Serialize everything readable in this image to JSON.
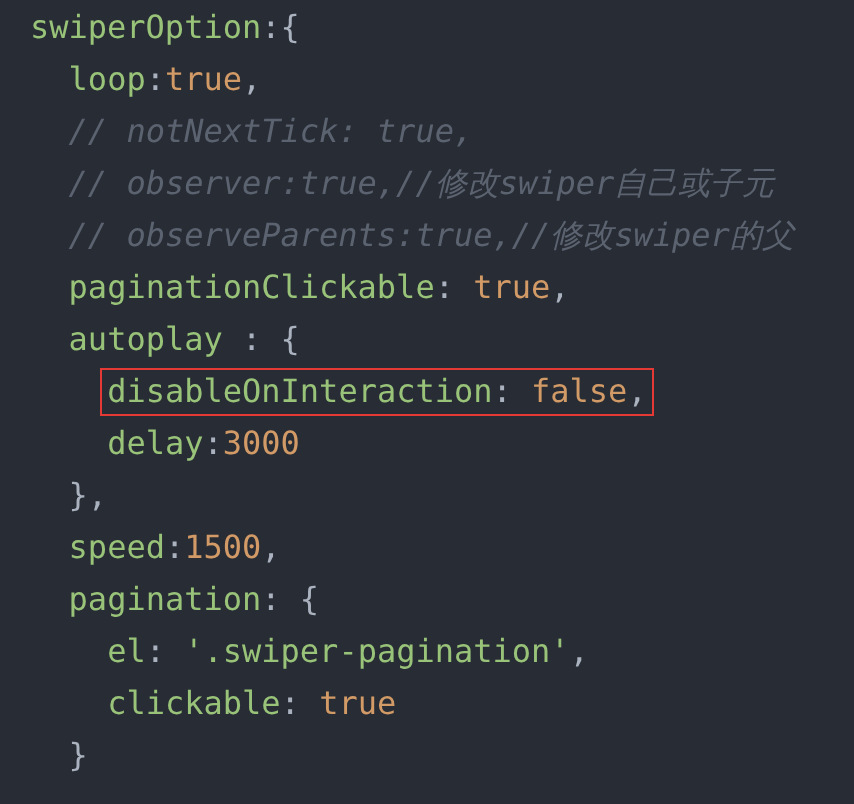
{
  "code_lines": [
    {
      "highlighted": false,
      "tokens": [
        {
          "kind": "key",
          "text": "swiperOption"
        },
        {
          "kind": "punct",
          "text": ":{"
        }
      ],
      "children": [
        {
          "highlighted": false,
          "tokens": [
            {
              "kind": "key",
              "text": "loop"
            },
            {
              "kind": "punct",
              "text": ":"
            },
            {
              "kind": "literal",
              "text": "true"
            },
            {
              "kind": "punct",
              "text": ","
            }
          ]
        },
        {
          "highlighted": false,
          "tokens": [
            {
              "kind": "comment",
              "text": "// notNextTick: true,"
            }
          ]
        },
        {
          "highlighted": false,
          "tokens": [
            {
              "kind": "comment",
              "text": "// observer:true,//修改swiper自己或子元"
            }
          ]
        },
        {
          "highlighted": false,
          "tokens": [
            {
              "kind": "comment",
              "text": "// observeParents:true,//修改swiper的父"
            }
          ]
        },
        {
          "highlighted": false,
          "tokens": [
            {
              "kind": "key",
              "text": "paginationClickable"
            },
            {
              "kind": "punct",
              "text": ": "
            },
            {
              "kind": "literal",
              "text": "true"
            },
            {
              "kind": "punct",
              "text": ","
            }
          ]
        },
        {
          "highlighted": false,
          "tokens": [
            {
              "kind": "key",
              "text": "autoplay"
            },
            {
              "kind": "punct",
              "text": " : {"
            }
          ],
          "children": [
            {
              "highlighted": true,
              "tokens": [
                {
                  "kind": "key",
                  "text": "disableOnInteraction"
                },
                {
                  "kind": "punct",
                  "text": ": "
                },
                {
                  "kind": "literal",
                  "text": "false"
                },
                {
                  "kind": "punct",
                  "text": ","
                }
              ]
            },
            {
              "highlighted": false,
              "tokens": [
                {
                  "kind": "key",
                  "text": "delay"
                },
                {
                  "kind": "punct",
                  "text": ":"
                },
                {
                  "kind": "literal",
                  "text": "3000"
                }
              ]
            }
          ]
        },
        {
          "highlighted": false,
          "tokens": [
            {
              "kind": "punct",
              "text": "},"
            }
          ]
        },
        {
          "highlighted": false,
          "tokens": [
            {
              "kind": "key",
              "text": "speed"
            },
            {
              "kind": "punct",
              "text": ":"
            },
            {
              "kind": "literal",
              "text": "1500"
            },
            {
              "kind": "punct",
              "text": ","
            }
          ]
        },
        {
          "highlighted": false,
          "tokens": [
            {
              "kind": "key",
              "text": "pagination"
            },
            {
              "kind": "punct",
              "text": ": {"
            }
          ],
          "children": [
            {
              "highlighted": false,
              "tokens": [
                {
                  "kind": "key",
                  "text": "el"
                },
                {
                  "kind": "punct",
                  "text": ": "
                },
                {
                  "kind": "string",
                  "text": "'.swiper-pagination'"
                },
                {
                  "kind": "punct",
                  "text": ","
                }
              ]
            },
            {
              "highlighted": false,
              "tokens": [
                {
                  "kind": "key",
                  "text": "clickable"
                },
                {
                  "kind": "punct",
                  "text": ": "
                },
                {
                  "kind": "literal",
                  "text": "true"
                }
              ]
            }
          ]
        },
        {
          "highlighted": false,
          "tokens": [
            {
              "kind": "punct",
              "text": "}"
            }
          ]
        }
      ]
    }
  ]
}
